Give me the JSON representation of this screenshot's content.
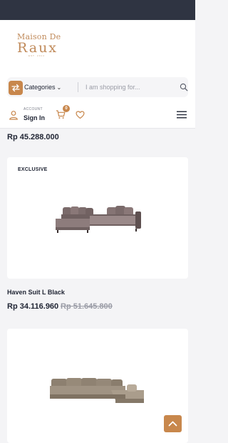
{
  "brand": {
    "line1": "Maison De",
    "line2": "Raux",
    "tagline": "EST. 2014"
  },
  "search": {
    "categories_label": "Categories",
    "placeholder": "I am shopping for..."
  },
  "account": {
    "label": "ACCOUNT",
    "signin": "Sign In"
  },
  "cart": {
    "count": "0"
  },
  "products": [
    {
      "price": "Rp 45.288.000"
    },
    {
      "badge": "EXCLUSIVE",
      "name": "Haven Suit L Black",
      "price": "Rp 34.116.960",
      "old_price": "Rp 51.645.800"
    },
    {}
  ],
  "icons": {
    "switch": "arrows-switch-icon",
    "chevron": "chevron-down-icon",
    "search": "search-icon",
    "account": "user-icon",
    "cart": "cart-icon",
    "wishlist": "heart-icon",
    "menu": "hamburger-menu-icon",
    "back_to_top": "chevron-up-icon"
  },
  "colors": {
    "accent": "#c8874c",
    "topbar": "#2f3442",
    "text": "#1f2433",
    "muted": "#9a9ca6",
    "background": "#f4f4f6"
  }
}
